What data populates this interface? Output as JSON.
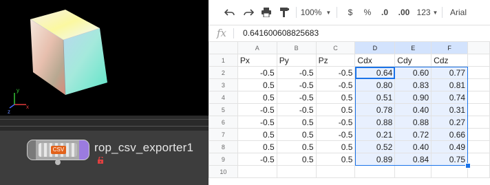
{
  "houdini": {
    "node_label": "rop_csv_exporter1",
    "node_badge": "CSV",
    "axis": {
      "x": "x",
      "y": "y",
      "z": "z"
    }
  },
  "sheet": {
    "toolbar": {
      "zoom": "100%",
      "currency": "$",
      "percent": "%",
      "dec_less": ".0",
      "dec_more": ".00",
      "format_more": "123",
      "font": "Arial"
    },
    "formula_value": "0.641600608825683",
    "fx_label": "fx",
    "columns": [
      "A",
      "B",
      "C",
      "D",
      "E",
      "F"
    ],
    "selected_columns": [
      "D",
      "E",
      "F"
    ],
    "rows": [
      {
        "n": "1",
        "cells": [
          "Px",
          "Py",
          "Pz",
          "Cdx",
          "Cdy",
          "Cdz"
        ]
      },
      {
        "n": "2",
        "cells": [
          "-0.5",
          "-0.5",
          "-0.5",
          "0.64",
          "0.60",
          "0.77"
        ]
      },
      {
        "n": "3",
        "cells": [
          "0.5",
          "-0.5",
          "-0.5",
          "0.80",
          "0.83",
          "0.81"
        ]
      },
      {
        "n": "4",
        "cells": [
          "0.5",
          "-0.5",
          "0.5",
          "0.51",
          "0.90",
          "0.74"
        ]
      },
      {
        "n": "5",
        "cells": [
          "-0.5",
          "-0.5",
          "0.5",
          "0.78",
          "0.40",
          "0.31"
        ]
      },
      {
        "n": "6",
        "cells": [
          "-0.5",
          "0.5",
          "-0.5",
          "0.88",
          "0.88",
          "0.27"
        ]
      },
      {
        "n": "7",
        "cells": [
          "0.5",
          "0.5",
          "-0.5",
          "0.21",
          "0.72",
          "0.66"
        ]
      },
      {
        "n": "8",
        "cells": [
          "0.5",
          "0.5",
          "0.5",
          "0.52",
          "0.40",
          "0.49"
        ]
      },
      {
        "n": "9",
        "cells": [
          "-0.5",
          "0.5",
          "0.5",
          "0.89",
          "0.84",
          "0.75"
        ]
      },
      {
        "n": "10",
        "cells": [
          "",
          "",
          "",
          "",
          "",
          ""
        ]
      }
    ]
  }
}
